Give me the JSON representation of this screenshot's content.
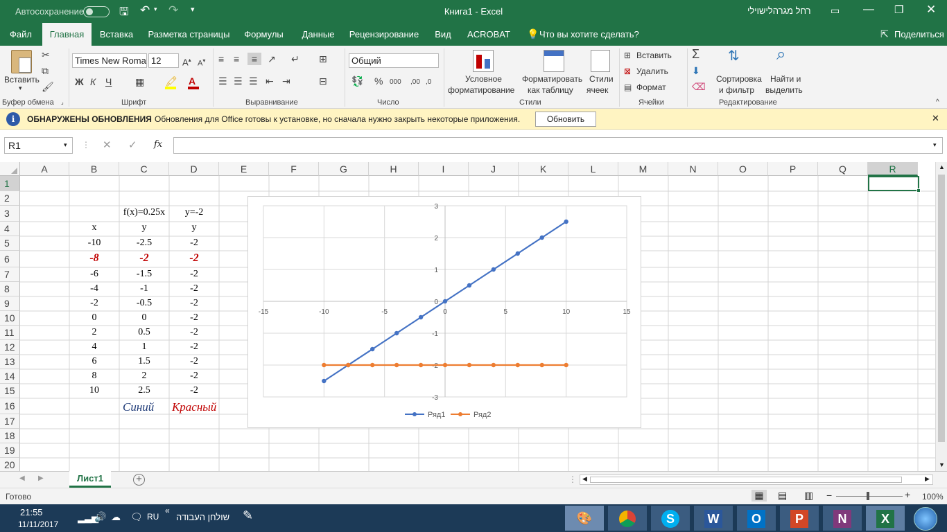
{
  "titlebar": {
    "autosave_label": "Автосохранение",
    "title": "Книга1  -  Excel",
    "user": "רחל מגרהלישוילי"
  },
  "tabs": [
    {
      "label": "Файл"
    },
    {
      "label": "Главная"
    },
    {
      "label": "Вставка"
    },
    {
      "label": "Разметка страницы"
    },
    {
      "label": "Формулы"
    },
    {
      "label": "Данные"
    },
    {
      "label": "Рецензирование"
    },
    {
      "label": "Вид"
    },
    {
      "label": "ACROBAT"
    }
  ],
  "tell_me": "Что вы хотите сделать?",
  "share": "Поделиться",
  "ribbon": {
    "paste": "Вставить",
    "font_name": "Times New Roma",
    "font_size": "12",
    "bold": "Ж",
    "italic": "К",
    "underline": "Ч",
    "number_format": "Общий",
    "percent": "%",
    "thousands": "000",
    "cond_format_1": "Условное",
    "cond_format_2": "форматирование",
    "format_table_1": "Форматировать",
    "format_table_2": "как таблицу",
    "cell_styles_1": "Стили",
    "cell_styles_2": "ячеек",
    "insert_cells": "Вставить",
    "delete_cells": "Удалить",
    "format_cells": "Формат",
    "sort_1": "Сортировка",
    "sort_2": "и фильтр",
    "find_1": "Найти и",
    "find_2": "выделить",
    "groups": {
      "clipboard": "Буфер обмена",
      "font": "Шрифт",
      "alignment": "Выравнивание",
      "number": "Число",
      "styles": "Стили",
      "cells": "Ячейки",
      "editing": "Редактирование"
    }
  },
  "infobar": {
    "title": "ОБНАРУЖЕНЫ ОБНОВЛЕНИЯ",
    "message": "Обновления для Office готовы к установке, но сначала нужно закрыть некоторые приложения.",
    "button": "Обновить"
  },
  "formula": {
    "name_box": "R1",
    "fx": "fx",
    "value": ""
  },
  "columns": [
    "A",
    "B",
    "C",
    "D",
    "E",
    "F",
    "G",
    "H",
    "I",
    "J",
    "K",
    "L",
    "M",
    "N",
    "O",
    "P",
    "Q",
    "R"
  ],
  "rows": [
    "1",
    "2",
    "3",
    "4",
    "5",
    "6",
    "7",
    "8",
    "9",
    "10",
    "11",
    "12",
    "13",
    "14",
    "15",
    "16",
    "17",
    "18",
    "19",
    "20"
  ],
  "sheet": {
    "c3": "f(x)=0.25x",
    "d3": "y=-2",
    "b4": "x",
    "c4": "y",
    "d4": "y",
    "table": [
      [
        "-10",
        "-2.5",
        "-2"
      ],
      [
        "-8",
        "-2",
        "-2"
      ],
      [
        "-6",
        "-1.5",
        "-2"
      ],
      [
        "-4",
        "-1",
        "-2"
      ],
      [
        "-2",
        "-0.5",
        "-2"
      ],
      [
        "0",
        "0",
        "-2"
      ],
      [
        "2",
        "0.5",
        "-2"
      ],
      [
        "4",
        "1",
        "-2"
      ],
      [
        "6",
        "1.5",
        "-2"
      ],
      [
        "8",
        "2",
        "-2"
      ],
      [
        "10",
        "2.5",
        "-2"
      ]
    ],
    "c16": "Синий",
    "d16": "Красный"
  },
  "chart_data": {
    "type": "line",
    "x": [
      -10,
      -8,
      -6,
      -4,
      -2,
      0,
      2,
      4,
      6,
      8,
      10
    ],
    "series": [
      {
        "name": "Ряд1",
        "values": [
          -2.5,
          -2,
          -1.5,
          -1,
          -0.5,
          0,
          0.5,
          1,
          1.5,
          2,
          2.5
        ],
        "color": "#4472c4"
      },
      {
        "name": "Ряд2",
        "values": [
          -2,
          -2,
          -2,
          -2,
          -2,
          -2,
          -2,
          -2,
          -2,
          -2,
          -2
        ],
        "color": "#ed7d31"
      }
    ],
    "xlim": [
      -15,
      15
    ],
    "ylim": [
      -3,
      3
    ],
    "xticks": [
      "-15",
      "-10",
      "-5",
      "0",
      "5",
      "10",
      "15"
    ],
    "yticks": [
      "3",
      "2",
      "1",
      "0",
      "-1",
      "-2",
      "-3"
    ],
    "grid": true,
    "legend": "bottom"
  },
  "sheet_tab": "Лист1",
  "status": {
    "ready": "Готово",
    "zoom": "100%"
  },
  "taskbar": {
    "time": "21:55",
    "date": "11/11/2017",
    "lang": "RU",
    "desktop": "שולחן העבודה"
  },
  "colors": {
    "excel_green": "#217346",
    "info_bg": "#fff4c2"
  }
}
